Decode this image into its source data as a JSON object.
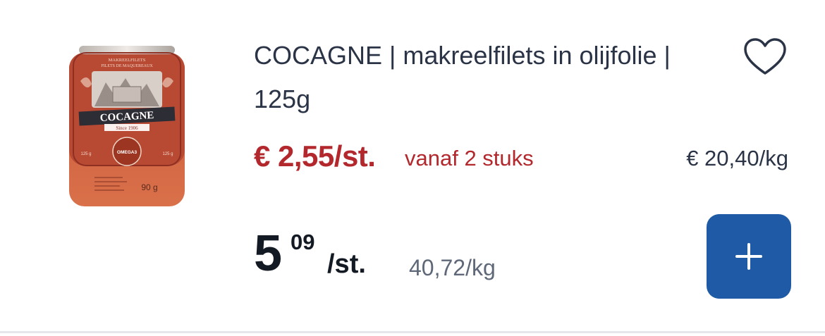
{
  "product": {
    "title": "COCAGNE | makreelfilets in olijfolie | 125g",
    "image_text": {
      "top_label_1": "MAKREELFILETS",
      "top_label_2": "FILETS DE MAQUEREAUX",
      "brand": "COCAGNE",
      "since": "Since 1906",
      "badge": "OMEGA3",
      "weight_left": "125 g",
      "weight_right": "125 g",
      "net_weight": "90 g"
    }
  },
  "promo": {
    "price": "€ 2,55/st.",
    "condition": "vanaf 2 stuks",
    "per_kg": "€ 20,40/kg"
  },
  "price": {
    "integer": "5",
    "decimals": "09",
    "unit": "/st.",
    "per_kg": "40,72/kg"
  },
  "actions": {
    "favorite_icon": "heart-icon",
    "add_icon": "plus-icon"
  },
  "colors": {
    "promo": "#b3282d",
    "button": "#1f5aa6",
    "title": "#2b3446"
  }
}
